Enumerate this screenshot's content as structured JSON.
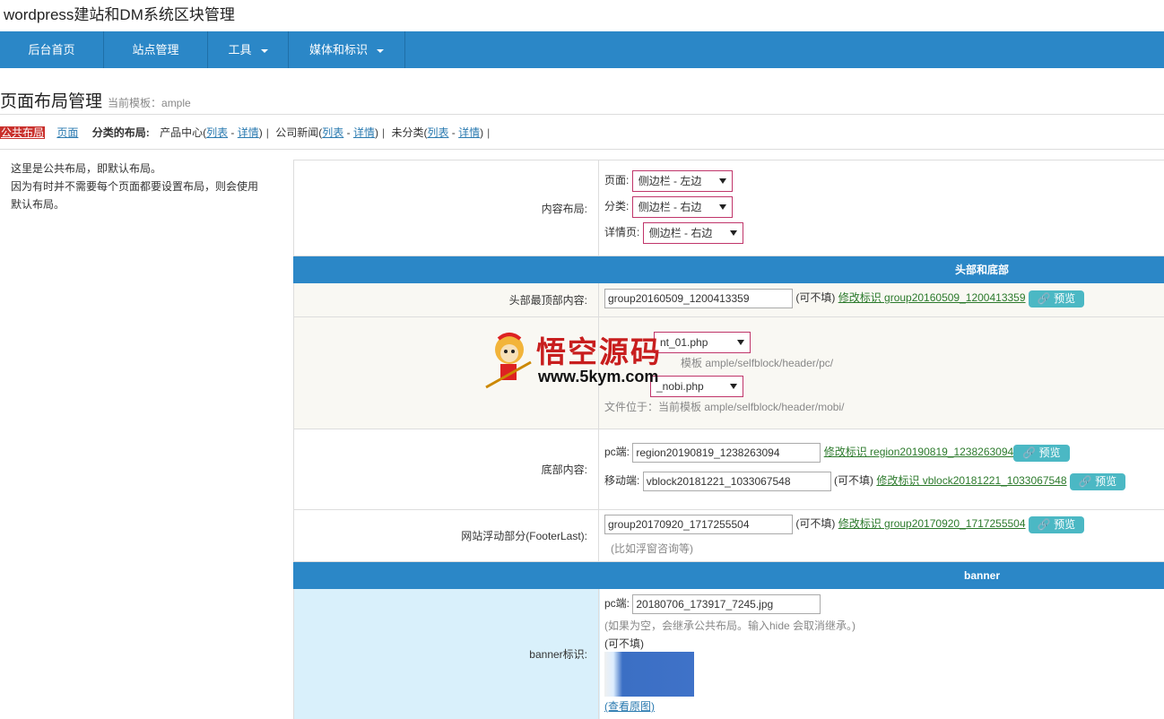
{
  "app": {
    "title": "wordpress建站和DM系统区块管理"
  },
  "nav": {
    "items": [
      {
        "label": "后台首页",
        "dropdown": false
      },
      {
        "label": "站点管理",
        "dropdown": false
      },
      {
        "label": "工具",
        "dropdown": true
      },
      {
        "label": "媒体和标识",
        "dropdown": true
      }
    ]
  },
  "page": {
    "title": "页面布局管理",
    "subtitle": "当前模板：ample"
  },
  "layout_bar": {
    "public": "公共布局",
    "page": "页面",
    "category_label": "分类的布局:",
    "groups": [
      {
        "name": "产品中心",
        "list": "列表",
        "detail": "详情"
      },
      {
        "name": "公司新闻",
        "list": "列表",
        "detail": "详情"
      },
      {
        "name": "未分类",
        "list": "列表",
        "detail": "详情"
      }
    ]
  },
  "note": {
    "lines": [
      "这里是公共布局，即默认布局。",
      "因为有时并不需要每个页面都要设置布局，则会使用",
      "默认布局。"
    ]
  },
  "content_layout": {
    "label": "内容布局:",
    "page_label": "页面:",
    "page_value": "侧边栏 - 左边",
    "category_label": "分类:",
    "category_value": "侧边栏 - 右边",
    "detail_label": "详情页:",
    "detail_value": "侧边栏 - 右边"
  },
  "band1": {
    "label": "头部和底部"
  },
  "header_top": {
    "label": "头部最顶部内容:",
    "value": "group20160509_1200413359",
    "optional": "(可不填)",
    "edit_link": "修改标识 group20160509_1200413359",
    "preview": "预览"
  },
  "header_tpl": {
    "pc_value": "nt_01.php",
    "pc_path": "模板 ample/selfblock/header/pc/",
    "mobi_value": "_nobi.php",
    "mobi_path": "文件位于：当前模板 ample/selfblock/header/mobi/"
  },
  "footer": {
    "label": "底部内容:",
    "pc_label": "pc端:",
    "pc_value": "region20190819_1238263094",
    "pc_link": "修改标识 region20190819_1238263094",
    "pc_preview": "预览",
    "mobile_label": "移动端:",
    "mobile_value": "vblock20181221_1033067548",
    "mobile_optional": "(可不填)",
    "mobile_link": "修改标识 vblock20181221_1033067548",
    "mobile_preview": "预览"
  },
  "float": {
    "label": "网站浮动部分(FooterLast):",
    "value": "group20170920_1717255504",
    "optional": "(可不填)",
    "edit_link": "修改标识 group20170920_1717255504",
    "preview": "预览",
    "hint": "(比如浮窗咨询等)"
  },
  "band2": {
    "label": "banner"
  },
  "banner": {
    "label": "banner标识:",
    "pc_label": "pc端:",
    "pc_value": "20180706_173917_7245.jpg",
    "hint": "(如果为空，会继承公共布局。输入hide 会取消继承。)",
    "optional": "(可不填)",
    "view_link": "(查看原图)"
  },
  "watermark": {
    "text": "悟空源码",
    "url": "www.5kym.com"
  },
  "colors": {
    "nav": "#2b87c7",
    "preview_btn": "#4bb8c4",
    "public_badge": "#c9302c"
  }
}
